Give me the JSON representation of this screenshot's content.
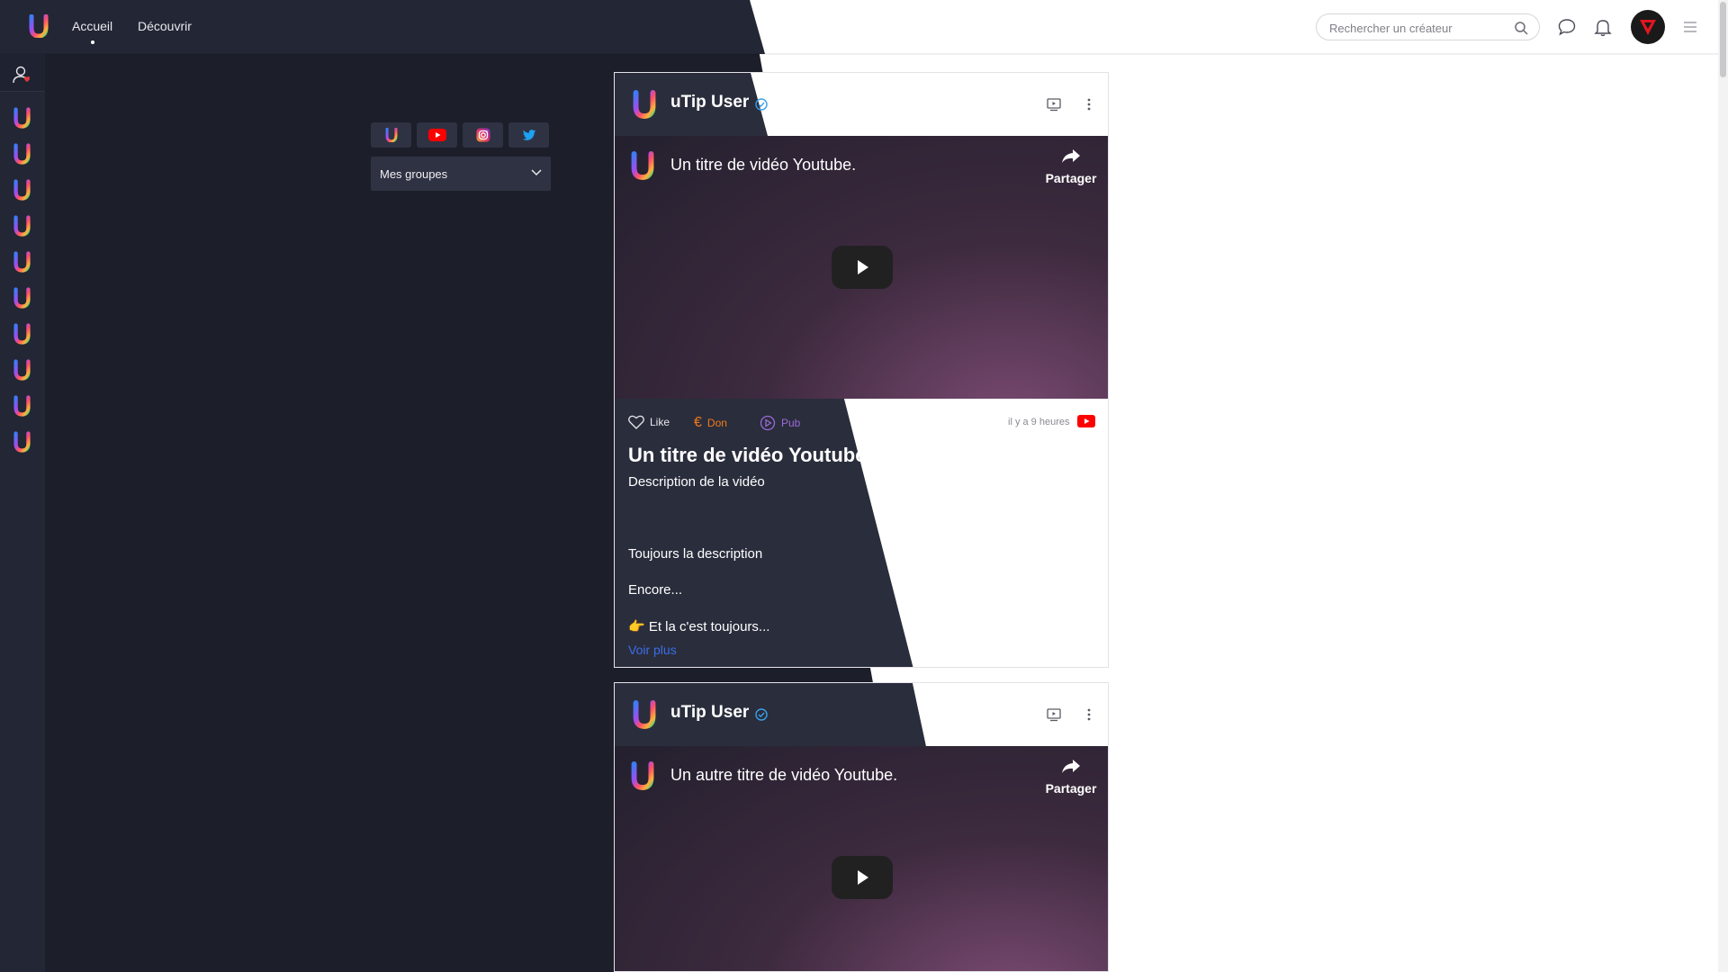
{
  "nav": {
    "home": "Accueil",
    "discover": "Découvrir"
  },
  "search": {
    "placeholder": "Rechercher un créateur"
  },
  "filters": {
    "groups_label": "Mes groupes"
  },
  "posts": [
    {
      "author": "uTip User",
      "video_title": "Un titre de vidéo Youtube.",
      "share_label": "Partager",
      "like_label": "Like",
      "donate_label": "Don",
      "ad_label": "Pub",
      "time": "il y a 9 heures",
      "title": "Un titre de vidéo Youtube.",
      "description": [
        "Description de la vidéo",
        "Toujours la description",
        "Encore...",
        "👉 Et la c'est toujours..."
      ],
      "more": "Voir plus"
    },
    {
      "author": "uTip User",
      "video_title": "Un autre titre de vidéo Youtube.",
      "share_label": "Partager"
    }
  ],
  "colors": {
    "dark_bg": "#1c1e2a",
    "panel": "#2a2d3c",
    "accent_link": "#3a6ee8",
    "donate": "#f07a1a",
    "ad": "#9b6bd8",
    "youtube": "#ff0000"
  }
}
